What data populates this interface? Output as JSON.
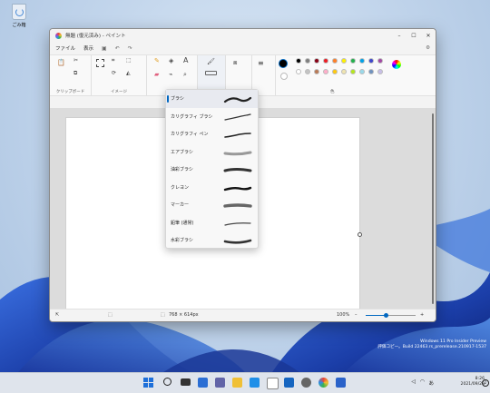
{
  "desktop": {
    "recycle_bin_label": "ごみ箱"
  },
  "window": {
    "title": "無題 (復元済み) - ペイント",
    "controls": {
      "minimize": "–",
      "maximize": "☐",
      "close": "✕"
    }
  },
  "menubar": {
    "file": "ファイル",
    "view": "表示"
  },
  "ribbon": {
    "clipboard_label": "クリップボード",
    "image_label": "イメージ",
    "shapes_label_partial": "形",
    "colors_label": "色",
    "palette_row1": [
      "#000000",
      "#7f7f7f",
      "#880015",
      "#ed1c24",
      "#ff7f27",
      "#fff200",
      "#22b14c",
      "#00a2e8",
      "#3f48cc",
      "#a349a4"
    ],
    "palette_row2": [
      "#ffffff",
      "#c3c3c3",
      "#b97a57",
      "#ffaec9",
      "#ffc90e",
      "#efe4b0",
      "#b5e61d",
      "#99d9ea",
      "#7092be",
      "#c8bfe7"
    ]
  },
  "brush_menu": {
    "items": [
      "ブラシ",
      "カリグラフィ ブラシ",
      "カリグラフィ ペン",
      "エアブラシ",
      "油彩ブラシ",
      "クレヨン",
      "マーカー",
      "鉛筆 (通常)",
      "水彩ブラシ"
    ],
    "selected_index": 0
  },
  "status": {
    "canvas_size": "768 × 614px",
    "zoom": "100%",
    "zoom_minus": "–",
    "zoom_plus": "+"
  },
  "watermark": {
    "line1": "Windows 11 Pro Insider Preview",
    "line2": "評価コピー。Build 22463.rs_prerelease.210917-1537"
  },
  "tray": {
    "time": "8:26",
    "date": "2021/09/28",
    "ime": "あ",
    "notifications": "2"
  }
}
